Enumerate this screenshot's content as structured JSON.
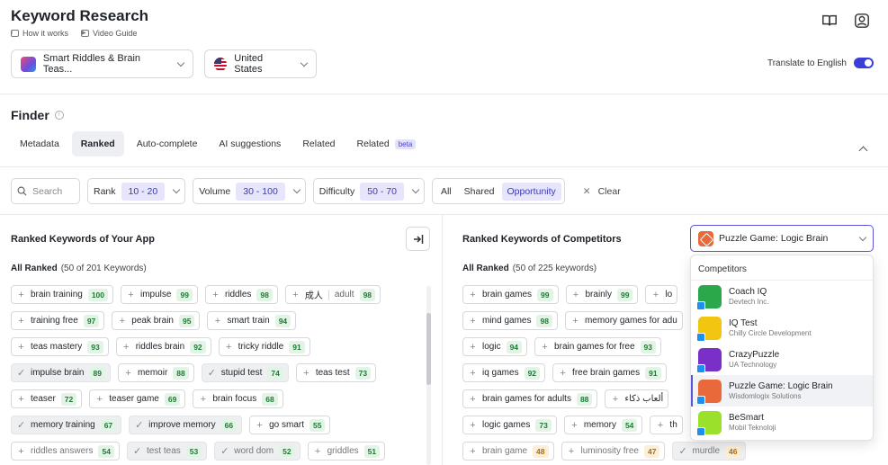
{
  "header": {
    "title": "Keyword Research",
    "how_it_works": "How it works",
    "video_guide": "Video Guide"
  },
  "app_selector": {
    "label": "Smart Riddles & Brain Teas..."
  },
  "country_selector": {
    "label": "United States"
  },
  "translate": {
    "label": "Translate to English",
    "enabled": true
  },
  "finder": {
    "title": "Finder",
    "tabs": [
      {
        "label": "Metadata"
      },
      {
        "label": "Ranked",
        "active": true
      },
      {
        "label": "Auto-complete"
      },
      {
        "label": "AI suggestions"
      },
      {
        "label": "Related"
      },
      {
        "label": "Related",
        "badge": "beta"
      }
    ]
  },
  "filters": {
    "search_placeholder": "Search",
    "rank_label": "Rank",
    "rank_value": "10 - 20",
    "volume_label": "Volume",
    "volume_value": "30 - 100",
    "difficulty_label": "Difficulty",
    "difficulty_value": "50 - 70",
    "segments": [
      "All",
      "Shared",
      "Opportunity"
    ],
    "active_segment": "Opportunity",
    "clear_label": "Clear"
  },
  "left_panel": {
    "title": "Ranked Keywords of Your App",
    "all_ranked": "All Ranked",
    "count": "(50 of 201 Keywords)",
    "rows": [
      [
        {
          "k": "brain training",
          "s": "100"
        },
        {
          "k": "impulse",
          "s": "99"
        },
        {
          "k": "riddles",
          "s": "98"
        },
        {
          "k": "成人",
          "t": "adult",
          "s": "98"
        }
      ],
      [
        {
          "k": "training free",
          "s": "97"
        },
        {
          "k": "peak brain",
          "s": "95"
        },
        {
          "k": "smart train",
          "s": "94"
        }
      ],
      [
        {
          "k": "teas mastery",
          "s": "93"
        },
        {
          "k": "riddles brain",
          "s": "92"
        },
        {
          "k": "tricky riddle",
          "s": "91"
        }
      ],
      [
        {
          "k": "impulse brain",
          "s": "89",
          "sel": true
        },
        {
          "k": "memoir",
          "s": "88"
        },
        {
          "k": "stupid test",
          "s": "74",
          "sel": true
        },
        {
          "k": "teas test",
          "s": "73"
        }
      ],
      [
        {
          "k": "teaser",
          "s": "72"
        },
        {
          "k": "teaser game",
          "s": "69"
        },
        {
          "k": "brain focus",
          "s": "68"
        }
      ],
      [
        {
          "k": "memory training",
          "s": "67",
          "sel": true
        },
        {
          "k": "improve memory",
          "s": "66",
          "sel": true
        },
        {
          "k": "go smart",
          "s": "55"
        }
      ],
      [
        {
          "k": "riddles answers",
          "s": "54",
          "f": true
        },
        {
          "k": "test teas",
          "s": "53",
          "sel": true,
          "f": true
        },
        {
          "k": "word dom",
          "s": "52",
          "sel": true,
          "f": true
        },
        {
          "k": "griddles",
          "s": "51",
          "f": true
        }
      ]
    ]
  },
  "right_panel": {
    "title": "Ranked Keywords of Competitors",
    "all_ranked": "All Ranked",
    "count": "(50 of 225 keywords)",
    "competitor_selected": "Puzzle Game: Logic Brain",
    "rows": [
      [
        {
          "k": "brain games",
          "s": "99"
        },
        {
          "k": "brainly",
          "s": "99"
        },
        {
          "k": "lo",
          "s": ""
        }
      ],
      [
        {
          "k": "mind games",
          "s": "98"
        },
        {
          "k": "memory games for adu",
          "s": ""
        }
      ],
      [
        {
          "k": "logic",
          "s": "94"
        },
        {
          "k": "brain games for free",
          "s": "93"
        }
      ],
      [
        {
          "k": "iq games",
          "s": "92"
        },
        {
          "k": "free brain games",
          "s": "91"
        }
      ],
      [
        {
          "k": "brain games for adults",
          "s": "88"
        },
        {
          "k": "ألعاب ذكاء",
          "s": ""
        }
      ],
      [
        {
          "k": "logic games",
          "s": "73"
        },
        {
          "k": "memory",
          "s": "54"
        },
        {
          "k": "th",
          "s": ""
        }
      ],
      [
        {
          "k": "brain game",
          "s": "48",
          "o": true,
          "f": true
        },
        {
          "k": "luminosity free",
          "s": "47",
          "o": true,
          "f": true
        },
        {
          "k": "murdle",
          "s": "46",
          "o": true,
          "sel": true,
          "f": true
        }
      ]
    ]
  },
  "competitors_dropdown": {
    "heading": "Competitors",
    "items": [
      {
        "name": "Coach IQ",
        "dev": "Devtech Inc.",
        "color": "#2aa84a"
      },
      {
        "name": "IQ Test",
        "dev": "Chilly Circle Development",
        "color": "#f2c511"
      },
      {
        "name": "CrazyPuzzle",
        "dev": "UA Technology",
        "color": "#7b2fc9"
      },
      {
        "name": "Puzzle Game: Logic Brain",
        "dev": "Wisdomlogix Solutions",
        "color": "#e86a3a",
        "highlighted": true
      },
      {
        "name": "BeSmart",
        "dev": "Mobil Teknoloji",
        "color": "#9be02a"
      }
    ]
  },
  "colors": {
    "accent": "#5a55d6",
    "score_green": "#1d7a34",
    "score_orange": "#b36a0a"
  }
}
